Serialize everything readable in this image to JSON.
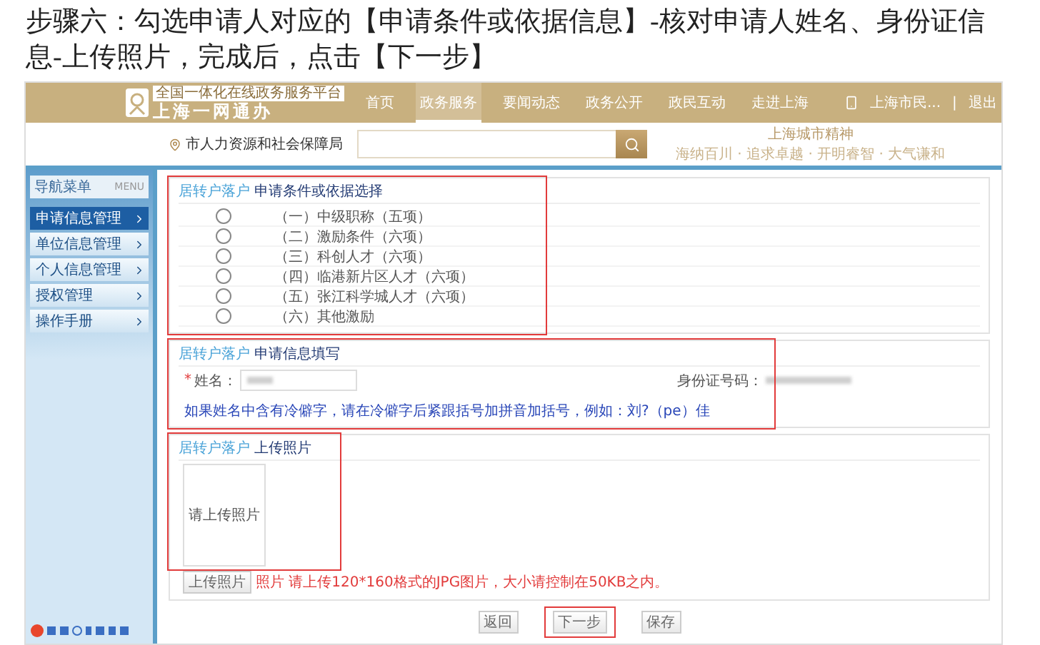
{
  "instruction": "步骤六：勾选申请人对应的【申请条件或依据信息】-核对申请人姓名、身份证信息-上传照片，完成后，点击【下一步】",
  "header": {
    "platform": "全国一体化在线政务服务平台",
    "logo": "上海一网通办",
    "nav": [
      {
        "label": "首页",
        "selected": false
      },
      {
        "label": "政务服务",
        "selected": true
      },
      {
        "label": "要闻动态",
        "selected": false
      },
      {
        "label": "政务公开",
        "selected": false
      },
      {
        "label": "政民互动",
        "selected": false
      },
      {
        "label": "走进上海",
        "selected": false
      }
    ],
    "user": "上海市民...",
    "separator": "|",
    "logout": "退出"
  },
  "search": {
    "department": "市人力资源和社会保障局",
    "spirit_title": "上海城市精神",
    "spirit_words": "海纳百川 · 追求卓越 · 开明睿智 · 大气谦和"
  },
  "sidebar": {
    "title": "导航菜单",
    "badge": "MENU",
    "items": [
      {
        "label": "申请信息管理",
        "selected": true
      },
      {
        "label": "单位信息管理",
        "selected": false
      },
      {
        "label": "个人信息管理",
        "selected": false
      },
      {
        "label": "授权管理",
        "selected": false
      },
      {
        "label": "操作手册",
        "selected": false
      }
    ]
  },
  "sections": [
    {
      "kind": "options",
      "prefix": "居转户落户",
      "title": "申请条件或依据选择",
      "highlighted": true,
      "options": [
        {
          "label": "（一）中级职称（五项）",
          "selected": false
        },
        {
          "label": "（二）激励条件（六项）",
          "selected": false
        },
        {
          "label": "（三）科创人才（六项）",
          "selected": false
        },
        {
          "label": "（四）临港新片区人才（六项）",
          "selected": false
        },
        {
          "label": "（五）张江科学城人才（六项）",
          "selected": false
        },
        {
          "label": "（六）其他激励",
          "selected": false
        }
      ]
    },
    {
      "kind": "fields",
      "prefix": "居转户落户",
      "title": "申请信息填写",
      "highlighted": true,
      "required_mark": "*",
      "name_label": "姓名：",
      "id_label": "身份证号码：",
      "hint": "如果姓名中含有冷僻字，请在冷僻字后紧跟括号加拼音加括号，例如：刘?（pe）佳"
    },
    {
      "kind": "photo",
      "prefix": "居转户落户",
      "title": "上传照片",
      "highlighted": true,
      "photo_placeholder": "请上传照片",
      "upload_button": "上传照片",
      "note": "照片 请上传120*160格式的JPG图片，大小请控制在50KB之内。"
    }
  ],
  "buttons": [
    {
      "label": "返回",
      "highlighted": false
    },
    {
      "label": "下一步",
      "highlighted": true
    },
    {
      "label": "保存",
      "highlighted": false
    }
  ]
}
